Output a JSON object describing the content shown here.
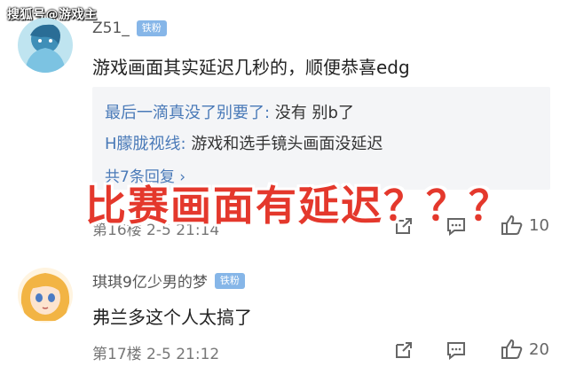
{
  "watermark": "搜狐号@游戏主",
  "overlay_text": "比赛画面有延迟？？？",
  "comments": [
    {
      "username": "Z51_",
      "badge": "铁粉",
      "text": "游戏画面其实延迟几秒的，顺便恭喜edg",
      "replies": [
        {
          "user": "最后一滴真没了别要了:",
          "text": " 没有 别b了"
        },
        {
          "user": "H朦胧视线:",
          "text": " 游戏和选手镜头画面没延迟"
        }
      ],
      "more_replies": "共7条回复 ›",
      "floor": "第16楼 2-5 21:14",
      "like_count": "10"
    },
    {
      "username": "琪琪9亿少男的梦",
      "badge": "铁粉",
      "text": "弗兰多这个人太搞了",
      "floor": "第17楼  2-5  21:12",
      "like_count": "20"
    }
  ],
  "icons": {
    "share": "share-icon",
    "comment": "comment-icon",
    "like": "thumbs-up-icon"
  }
}
